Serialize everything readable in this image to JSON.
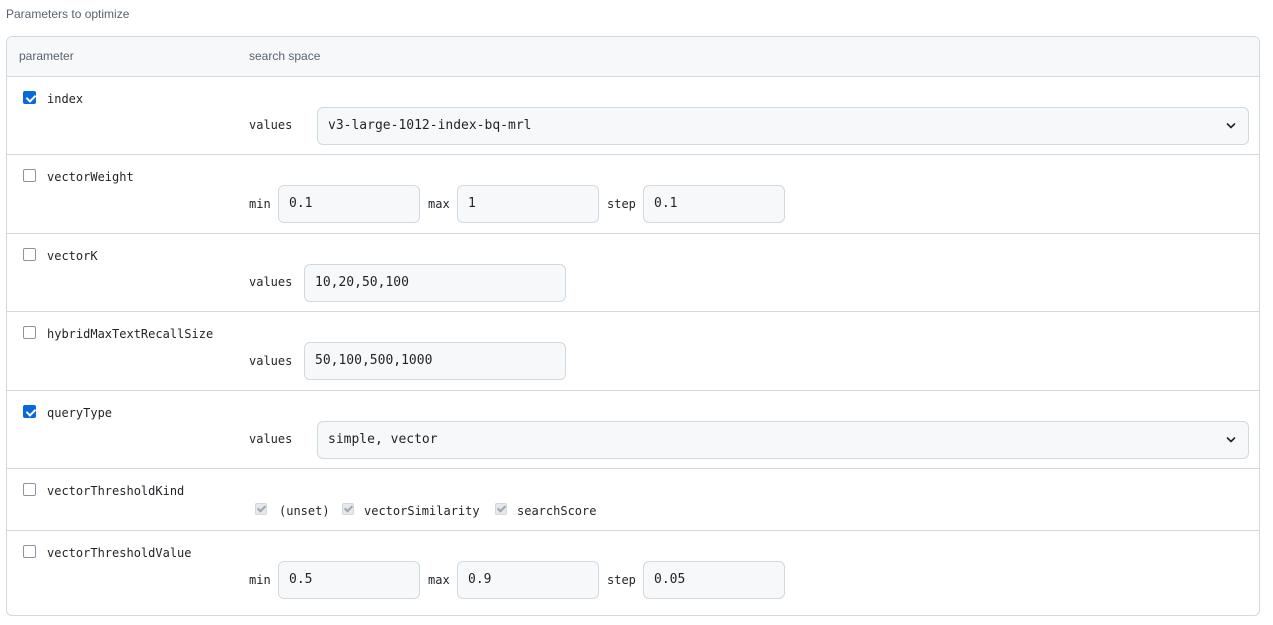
{
  "section_title": "Parameters to optimize",
  "table": {
    "col_parameter": "parameter",
    "col_search_space": "search space"
  },
  "params": {
    "index": {
      "name": "index",
      "checked": true,
      "label": "values",
      "value": "v3-large-1012-index-bq-mrl"
    },
    "vectorWeight": {
      "name": "vectorWeight",
      "checked": false,
      "min_label": "min",
      "min": "0.1",
      "max_label": "max",
      "max": "1",
      "step_label": "step",
      "step": "0.1"
    },
    "vectorK": {
      "name": "vectorK",
      "checked": false,
      "label": "values",
      "value": "10,20,50,100"
    },
    "hybridMaxTextRecallSize": {
      "name": "hybridMaxTextRecallSize",
      "checked": false,
      "label": "values",
      "value": "50,100,500,1000"
    },
    "queryType": {
      "name": "queryType",
      "checked": true,
      "label": "values",
      "value": "simple, vector"
    },
    "vectorThresholdKind": {
      "name": "vectorThresholdKind",
      "checked": false,
      "options": [
        "(unset)",
        "vectorSimilarity",
        "searchScore"
      ]
    },
    "vectorThresholdValue": {
      "name": "vectorThresholdValue",
      "checked": false,
      "min_label": "min",
      "min": "0.5",
      "max_label": "max",
      "max": "0.9",
      "step_label": "step",
      "step": "0.05"
    }
  },
  "icons": {
    "select_arrow": "chevron-down-icon",
    "checkbox_checked": "checkmark-icon"
  },
  "colors": {
    "accent": "#0969da",
    "border": "#d1d9e0",
    "header_bg": "#f6f8fa"
  }
}
